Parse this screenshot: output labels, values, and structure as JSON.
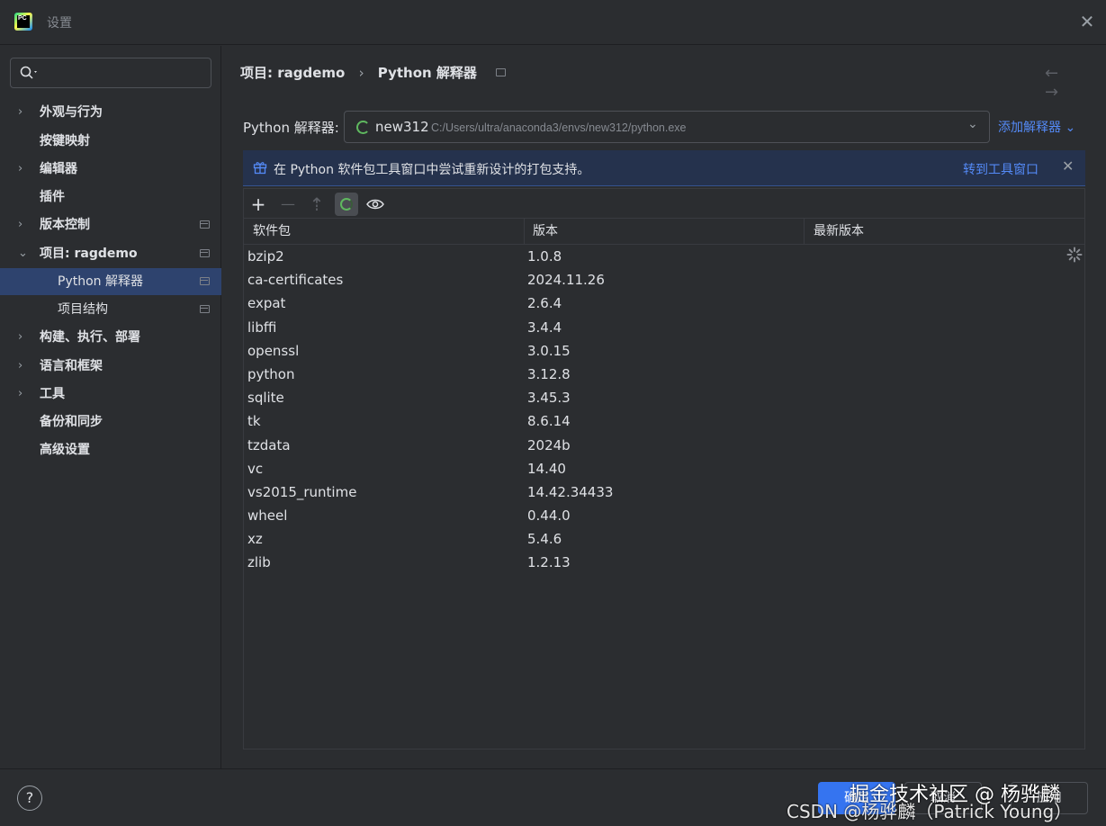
{
  "window": {
    "title": "设置",
    "close_glyph": "✕"
  },
  "search": {
    "placeholder": ""
  },
  "sidebar": {
    "items": [
      {
        "label": "外观与行为",
        "chevron": "›"
      },
      {
        "label": "按键映射",
        "chevron": ""
      },
      {
        "label": "编辑器",
        "chevron": "›"
      },
      {
        "label": "插件",
        "chevron": ""
      },
      {
        "label": "版本控制",
        "chevron": "›"
      },
      {
        "label": "项目: ragdemo",
        "chevron": "⌄"
      },
      {
        "label": "Python 解释器",
        "chevron": ""
      },
      {
        "label": "项目结构",
        "chevron": ""
      },
      {
        "label": "构建、执行、部署",
        "chevron": "›"
      },
      {
        "label": "语言和框架",
        "chevron": "›"
      },
      {
        "label": "工具",
        "chevron": "›"
      },
      {
        "label": "备份和同步",
        "chevron": ""
      },
      {
        "label": "高级设置",
        "chevron": ""
      }
    ]
  },
  "breadcrumb": {
    "project": "项目: ragdemo",
    "separator": "›",
    "page": "Python 解释器"
  },
  "nav": {
    "back": "←",
    "forward": "→"
  },
  "interpreter": {
    "label": "Python 解释器:",
    "name": "new312",
    "path": "C:/Users/ultra/anaconda3/envs/new312/python.exe",
    "dropdown_glyph": "⌄",
    "add_label": "添加解释器 ⌄"
  },
  "banner": {
    "message": "在 Python 软件包工具窗口中尝试重新设计的打包支持。",
    "link": "转到工具窗口",
    "close_glyph": "✕"
  },
  "toolbar": {
    "add": "+",
    "remove": "—",
    "upgrade": "⇡"
  },
  "table": {
    "headers": [
      "软件包",
      "版本",
      "最新版本"
    ],
    "rows": [
      {
        "name": "bzip2",
        "version": "1.0.8"
      },
      {
        "name": "ca-certificates",
        "version": "2024.11.26"
      },
      {
        "name": "expat",
        "version": "2.6.4"
      },
      {
        "name": "libffi",
        "version": "3.4.4"
      },
      {
        "name": "openssl",
        "version": "3.0.15"
      },
      {
        "name": "python",
        "version": "3.12.8"
      },
      {
        "name": "sqlite",
        "version": "3.45.3"
      },
      {
        "name": "tk",
        "version": "8.6.14"
      },
      {
        "name": "tzdata",
        "version": "2024b"
      },
      {
        "name": "vc",
        "version": "14.40"
      },
      {
        "name": "vs2015_runtime",
        "version": "14.42.34433"
      },
      {
        "name": "wheel",
        "version": "0.44.0"
      },
      {
        "name": "xz",
        "version": "5.4.6"
      },
      {
        "name": "zlib",
        "version": "1.2.13"
      }
    ]
  },
  "footer": {
    "help": "?",
    "ok": "确定",
    "cancel": "取消",
    "apply": "应用"
  },
  "watermark": {
    "line1": "掘金技术社区 @ 杨骅麟",
    "line2": "CSDN @杨骅麟（Patrick Young）"
  },
  "colors": {
    "accent": "#3574f0",
    "link": "#548af7",
    "selected": "#2e436e",
    "banner": "#25324d"
  }
}
